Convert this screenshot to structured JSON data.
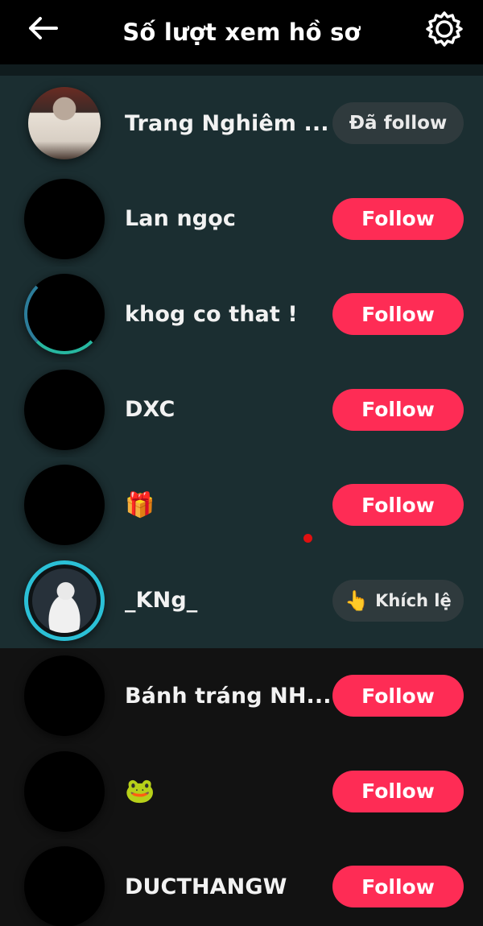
{
  "header": {
    "title": "Số lượt xem hồ sơ",
    "back_icon": "arrow-left-icon",
    "settings_icon": "gear-icon"
  },
  "colors": {
    "accent": "#fe2c55",
    "highlight_bg": "#1b2e31",
    "secondary_button": "#2f3a3d"
  },
  "viewers": [
    {
      "name": "Trang Nghiêm ...",
      "button": "Đã follow",
      "button_type": "following"
    },
    {
      "name": "Lan ngọc",
      "button": "Follow",
      "button_type": "follow"
    },
    {
      "name": "khog co that !",
      "button": "Follow",
      "button_type": "follow"
    },
    {
      "name": "DXC",
      "button": "Follow",
      "button_type": "follow"
    },
    {
      "name": "🎁",
      "button": "Follow",
      "button_type": "follow"
    },
    {
      "name": "_KNg_",
      "button": "Khích lệ",
      "button_icon": "👆",
      "button_type": "cheer"
    },
    {
      "name": "Bánh tráng NH...",
      "button": "Follow",
      "button_type": "follow"
    },
    {
      "name": "🐸",
      "button": "Follow",
      "button_type": "follow"
    },
    {
      "name": "DUCTHANGW",
      "button": "Follow",
      "button_type": "follow"
    }
  ]
}
